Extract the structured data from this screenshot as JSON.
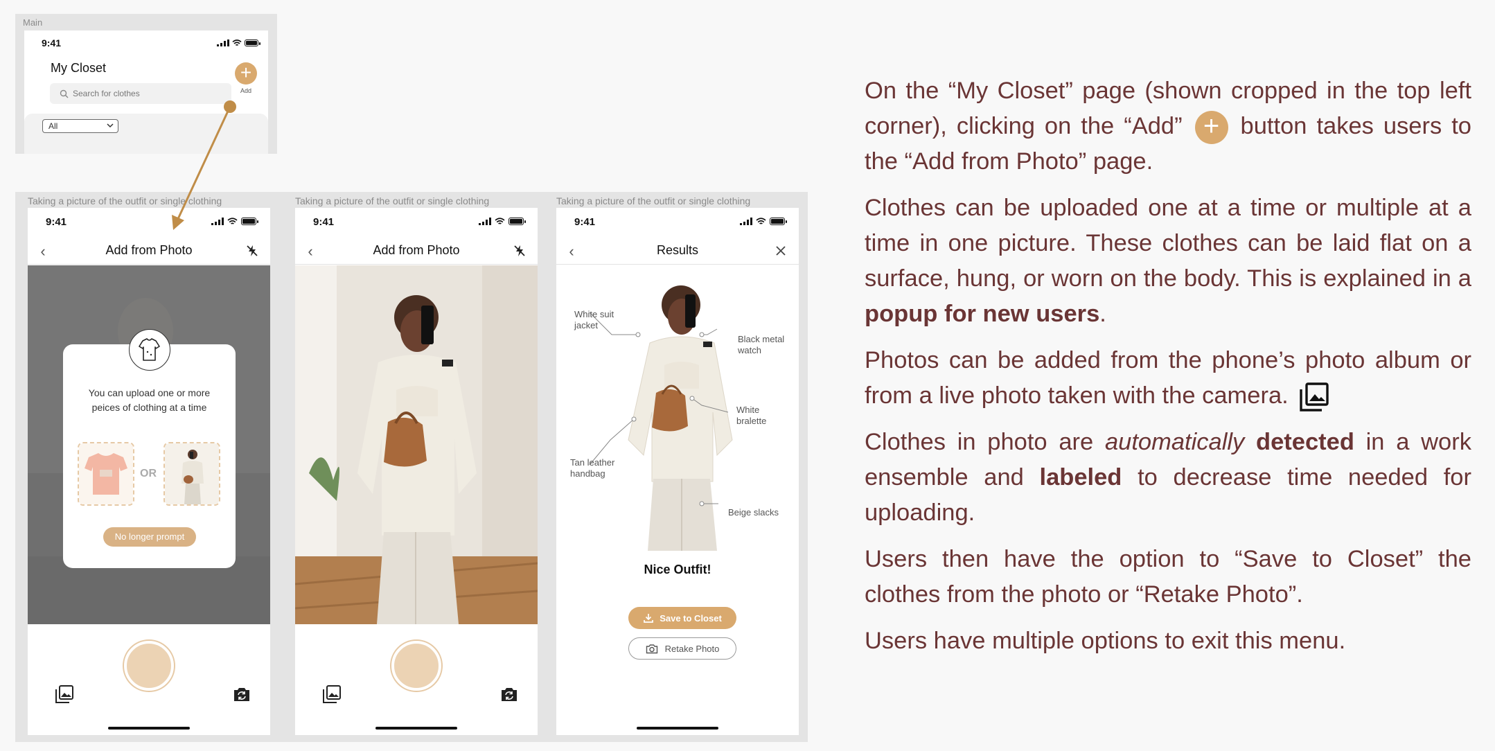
{
  "main_frame": {
    "label": "Main",
    "status_time": "9:41",
    "page_title": "My Closet",
    "add_label": "Add",
    "search_placeholder": "Search for clothes",
    "filter_value": "All"
  },
  "screens": [
    {
      "step_label": "Taking a picture of the outfit or single clothing",
      "status_time": "9:41",
      "nav_title": "Add from Photo",
      "popup": {
        "text": "You can upload one or more peices of clothing at a time",
        "or_label": "OR",
        "dismiss_label": "No longer prompt"
      }
    },
    {
      "step_label": "Taking a picture of the outfit or single clothing",
      "status_time": "9:41",
      "nav_title": "Add from Photo"
    },
    {
      "step_label": "Taking a picture of the outfit or single clothing",
      "status_time": "9:41",
      "nav_title": "Results",
      "annotations": [
        "White suit jacket",
        "Black metal watch",
        "White bralette",
        "Tan leather handbag",
        "Beige slacks"
      ],
      "result_message": "Nice Outfit!",
      "save_label": "Save to Closet",
      "retake_label": "Retake Photo"
    }
  ],
  "description": {
    "p1_a": "On the “My Closet” page (shown cropped in the top left corner), clicking on the “Add”",
    "p1_b": "button takes users to the “Add from Photo” page.",
    "p2_a": "Clothes can be uploaded one at a time or multiple at a time in one picture. These clothes can be laid flat on a surface, hung, or worn on the body. This is explained in a",
    "p2_bold": "popup for new users",
    "p2_end": ".",
    "p3": "Photos can be added from the phone’s photo album or from a live photo taken with the camera.",
    "p4_a": "Clothes in photo are",
    "p4_italic": "automatically",
    "p4_bold1": "detected",
    "p4_b": "in a work ensemble and",
    "p4_bold2": "labeled",
    "p4_c": "to decrease time needed for uploading.",
    "p5": "Users then have the option to “Save to Closet” the clothes from the photo or “Retake Photo”.",
    "p6": "Users have multiple options to exit this menu."
  },
  "colors": {
    "accent": "#d9a96e",
    "text_brown": "#6a3535",
    "frame_gray": "#e4e4e4"
  }
}
